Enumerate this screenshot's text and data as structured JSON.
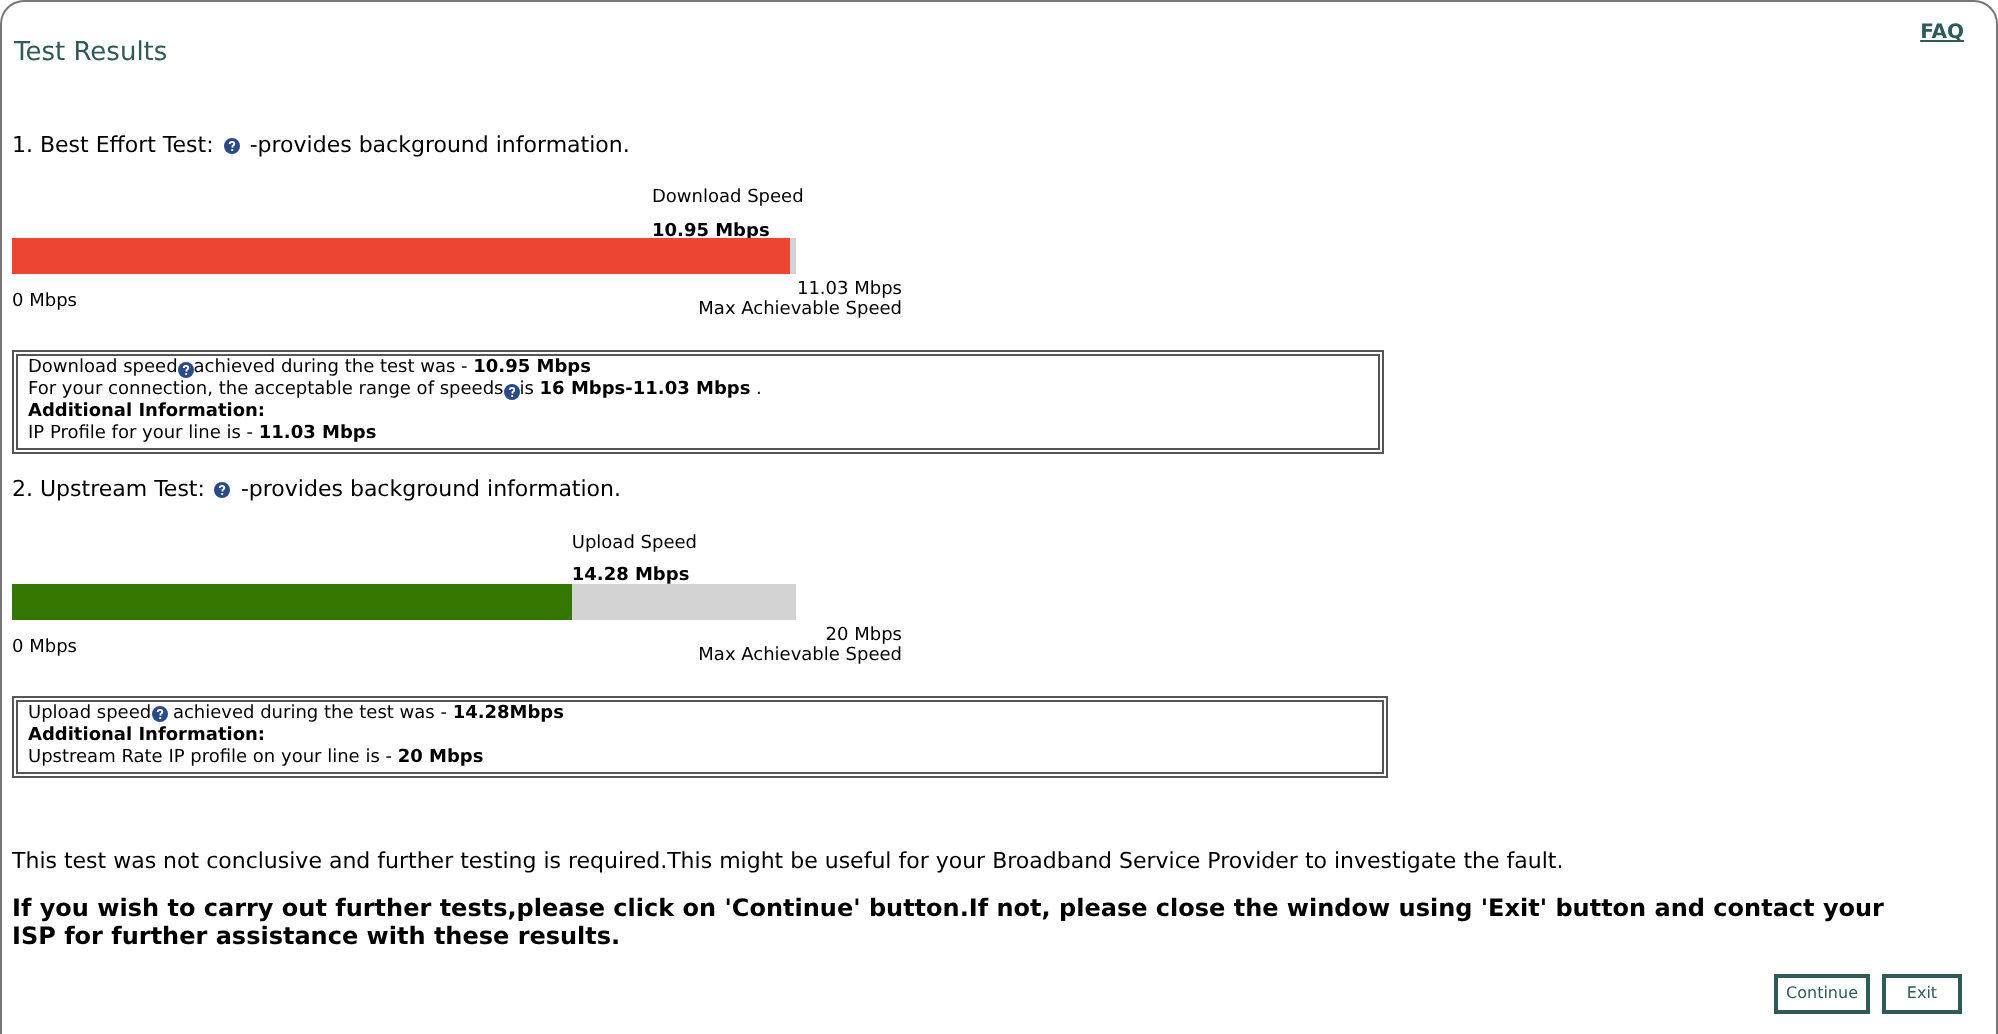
{
  "title": "Test Results",
  "faq_link": "FAQ",
  "tests": [
    {
      "heading": "1. Best Effort Test:",
      "help_text": "-provides background information.",
      "speed_label": "Download Speed",
      "speed_value": "10.95 Mbps",
      "level": 0.993,
      "color": "#ee4433",
      "min_label": "0 Mbps",
      "max_value": "11.03 Mbps",
      "max_label": "Max Achievable Speed",
      "info": [
        {
          "kind": "help",
          "before": "Download speed",
          "after": "achieved during the test was - **10.95 Mbps**"
        },
        {
          "kind": "help",
          "before": "For your connection, the acceptable range of speeds",
          "after": "is **16 Mbps-11.03 Mbps** ."
        },
        {
          "kind": "heading",
          "text": "Additional Information:"
        },
        {
          "kind": "plain",
          "text": "IP Profile for your line is - **11.03 Mbps**"
        }
      ]
    },
    {
      "heading": "2. Upstream Test:",
      "help_text": "-provides background information.",
      "speed_label": "Upload Speed",
      "speed_value": "14.28 Mbps",
      "level": 0.714,
      "color": "#337700",
      "min_label": "0 Mbps",
      "max_value": "20 Mbps",
      "max_label": "Max Achievable Speed",
      "info": [
        {
          "kind": "help",
          "before": "Upload speed",
          "after": " achieved during the test was - **14.28Mbps**"
        },
        {
          "kind": "heading",
          "text": "Additional Information:"
        },
        {
          "kind": "plain",
          "text": "Upstream Rate IP profile on your line is - **20 Mbps**"
        }
      ]
    }
  ],
  "note": "This test was not conclusive and further testing is required.This might be useful for your Broadband Service Provider to investigate the fault.",
  "instruction": "If you wish to carry out further tests,please click on 'Continue' button.If not, please close the window using 'Exit' button and contact your ISP for further assistance with these results.",
  "buttons": [
    "Continue",
    "Exit"
  ]
}
